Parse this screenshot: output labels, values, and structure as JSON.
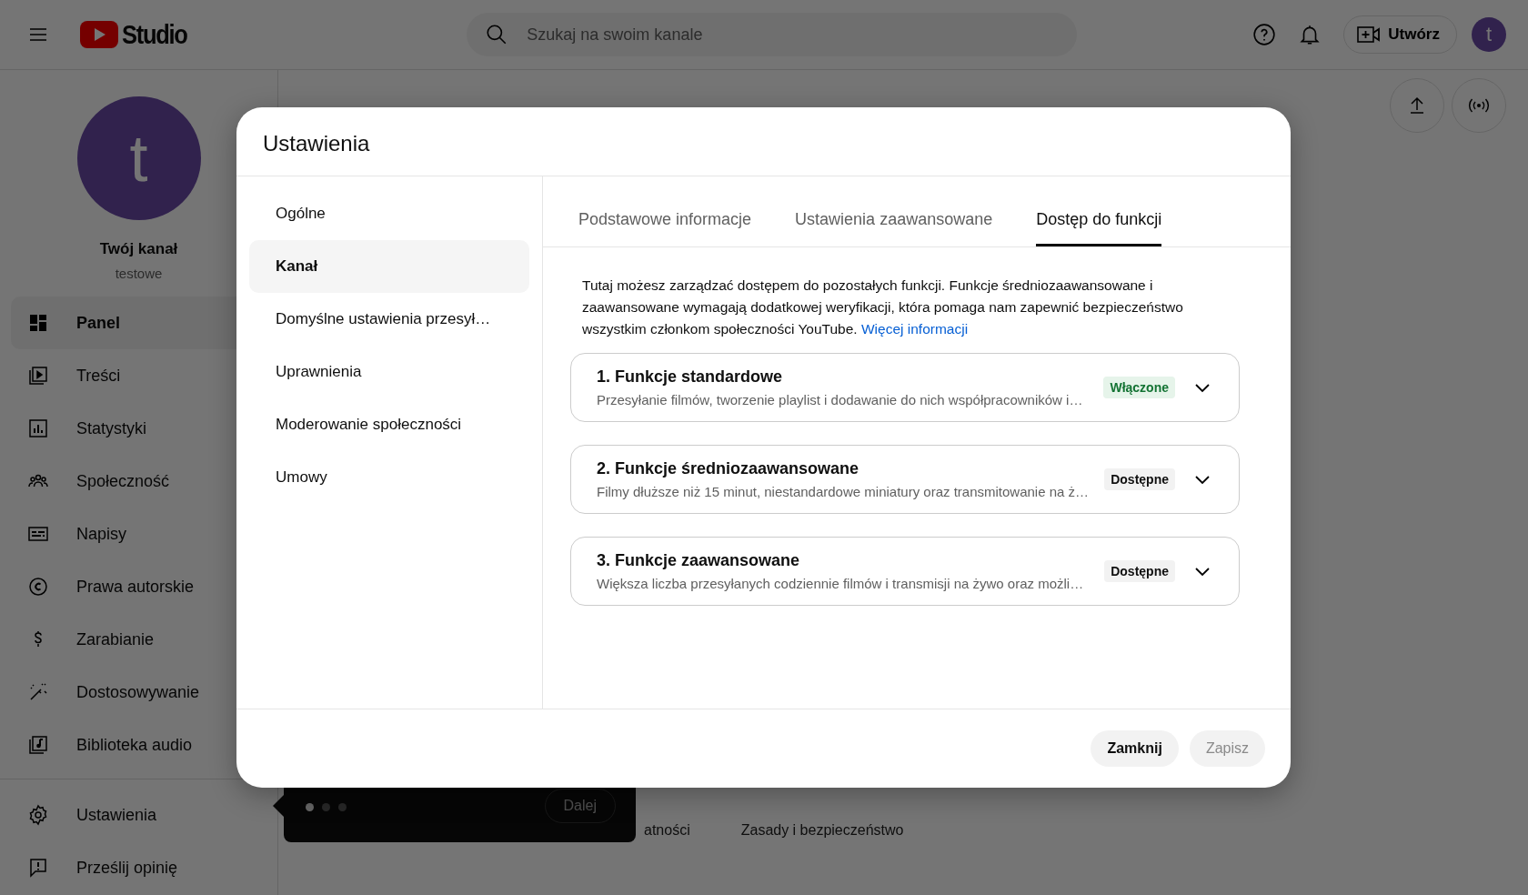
{
  "topbar": {
    "logo_text": "Studio",
    "search": {
      "placeholder": "Szukaj na swoim kanale"
    },
    "create_button": "Utwórz",
    "avatar_letter": "t"
  },
  "sidebar": {
    "channel": {
      "avatar_letter": "t",
      "name": "Twój kanał",
      "handle": "testowe"
    },
    "items": [
      {
        "label": "Panel",
        "selected": true
      },
      {
        "label": "Treści",
        "selected": false
      },
      {
        "label": "Statystyki",
        "selected": false
      },
      {
        "label": "Społeczność",
        "selected": false
      },
      {
        "label": "Napisy",
        "selected": false
      },
      {
        "label": "Prawa autorskie",
        "selected": false
      },
      {
        "label": "Zarabianie",
        "selected": false
      },
      {
        "label": "Dostosowywanie",
        "selected": false
      },
      {
        "label": "Biblioteka audio",
        "selected": false
      }
    ],
    "bottom_items": [
      {
        "label": "Ustawienia",
        "selected": false
      },
      {
        "label": "Prześlij opinię",
        "selected": false
      }
    ]
  },
  "page": {
    "footer_links": [
      "atności",
      "Zasady i bezpieczeństwo"
    ],
    "tooltip": {
      "dots": [
        {
          "selected": true
        },
        {
          "selected": false
        },
        {
          "selected": false
        }
      ],
      "next_button": "Dalej"
    }
  },
  "dialog": {
    "title": "Ustawienia",
    "nav": [
      {
        "label": "Ogólne",
        "selected": false
      },
      {
        "label": "Kanał",
        "selected": true
      },
      {
        "label": "Domyślne ustawienia przesył…",
        "selected": false
      },
      {
        "label": "Uprawnienia",
        "selected": false
      },
      {
        "label": "Moderowanie społeczności",
        "selected": false
      },
      {
        "label": "Umowy",
        "selected": false
      }
    ],
    "tabs": [
      {
        "label": "Podstawowe informacje",
        "selected": false
      },
      {
        "label": "Ustawienia zaawansowane",
        "selected": false
      },
      {
        "label": "Dostęp do funkcji",
        "selected": true
      }
    ],
    "description": "Tutaj możesz zarządzać dostępem do pozostałych funkcji. Funkcje średniozaawansowane i zaawansowane wymagają dodatkowej weryfikacji, która pomaga nam zapewnić bezpieczeństwo wszystkim członkom społeczności YouTube.",
    "link": "Więcej informacji",
    "features": [
      {
        "title": "1. Funkcje standardowe",
        "description": "Przesyłanie filmów, tworzenie playlist i dodawanie do nich współpracowników i…",
        "status": "Włączone",
        "kind": "enabled"
      },
      {
        "title": "2. Funkcje średniozaawansowane",
        "description": "Filmy dłuższe niż 15 minut, niestandardowe miniatury oraz transmitowanie na ż…",
        "status": "Dostępne",
        "kind": "available"
      },
      {
        "title": "3. Funkcje zaawansowane",
        "description": "Większa liczba przesyłanych codziennie filmów i transmisji na żywo oraz możli…",
        "status": "Dostępne",
        "kind": "available"
      }
    ],
    "buttons": [
      {
        "label": "Zamknij",
        "disabled": false
      },
      {
        "label": "Zapisz",
        "disabled": true
      }
    ]
  }
}
